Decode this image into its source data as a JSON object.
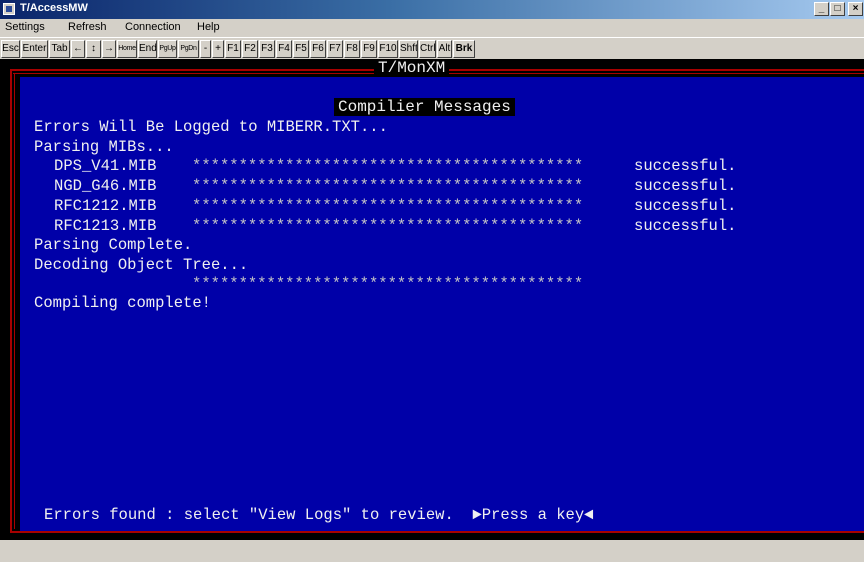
{
  "window": {
    "title": "T/AccessMW",
    "min": "_",
    "max": "□",
    "close": "×"
  },
  "menu": [
    "Settings",
    "Refresh",
    "Connection",
    "Help"
  ],
  "toolbar": [
    "Esc",
    "Enter",
    "Tab",
    "←",
    "↕",
    "→",
    "Home",
    "End",
    "PgUp",
    "PgDn",
    "-",
    "+",
    "F1",
    "F2",
    "F3",
    "F4",
    "F5",
    "F6",
    "F7",
    "F8",
    "F9",
    "F10",
    "Shft",
    "Ctrl",
    "Alt",
    "Brk"
  ],
  "terminal": {
    "app_title": "T/MonXM",
    "panel_title": "Compilier Messages",
    "lines": {
      "log_notice": "Errors Will Be Logged to MIBERR.TXT...",
      "parsing": "Parsing MIBs...",
      "complete": "Parsing Complete.",
      "decoding": "Decoding Object Tree...",
      "decoding_stars": "******************************************",
      "compiled": "Compiling complete!"
    },
    "mibs": [
      {
        "name": "DPS_V41.MIB",
        "stars": "******************************************",
        "status": "successful."
      },
      {
        "name": "NGD_G46.MIB",
        "stars": "******************************************",
        "status": "successful."
      },
      {
        "name": "RFC1212.MIB",
        "stars": "******************************************",
        "status": "successful."
      },
      {
        "name": "RFC1213.MIB",
        "stars": "******************************************",
        "status": "successful."
      }
    ],
    "footer": "Errors found : select \"View Logs\" to review.  ►Press a key◄"
  }
}
